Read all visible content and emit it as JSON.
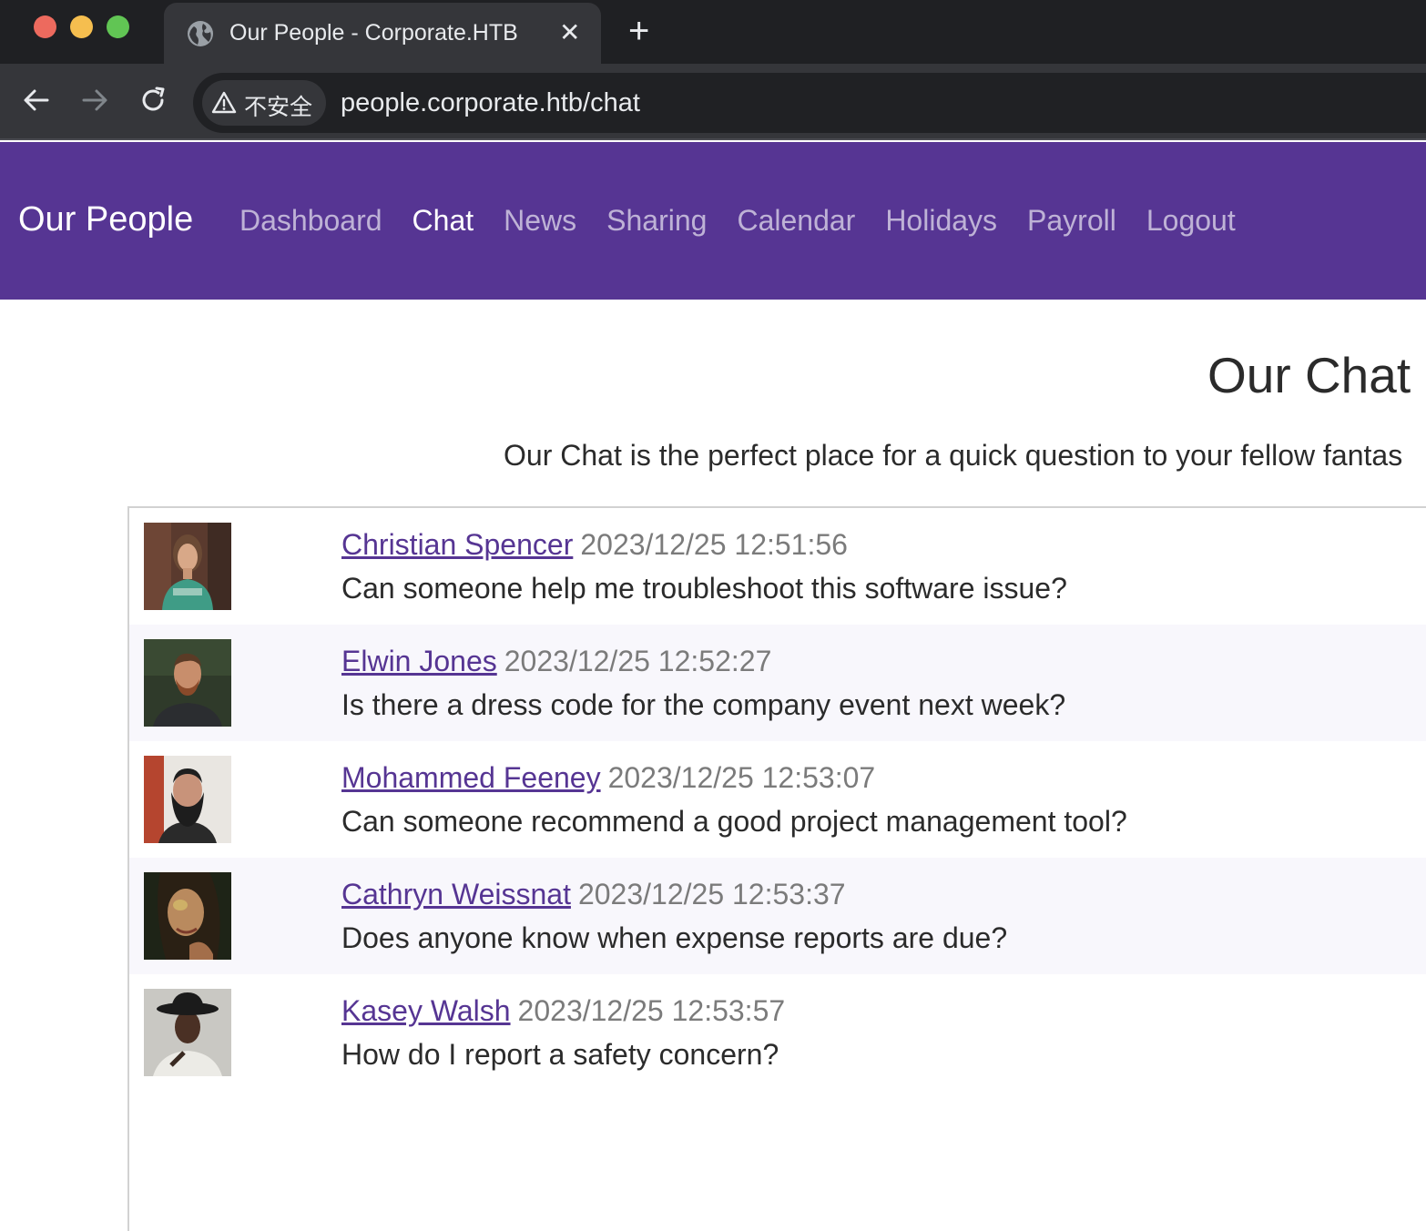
{
  "browser": {
    "tab_title": "Our People - Corporate.HTB",
    "tab_close": "✕",
    "new_tab": "+",
    "security_label": "不安全",
    "url": "people.corporate.htb/chat"
  },
  "navbar": {
    "brand": "Our People",
    "links": [
      {
        "label": "Dashboard",
        "active": false
      },
      {
        "label": "Chat",
        "active": true
      },
      {
        "label": "News",
        "active": false
      },
      {
        "label": "Sharing",
        "active": false
      },
      {
        "label": "Calendar",
        "active": false
      },
      {
        "label": "Holidays",
        "active": false
      },
      {
        "label": "Payroll",
        "active": false
      },
      {
        "label": "Logout",
        "active": false
      }
    ],
    "color": "#563593"
  },
  "page": {
    "title": "Our Chat",
    "lead": "Our Chat is the perfect place for a quick question to your fellow fantas"
  },
  "messages": [
    {
      "author": "Christian Spencer",
      "time": "2023/12/25 12:51:56",
      "text": "Can someone help me troubleshoot this software issue?"
    },
    {
      "author": "Elwin Jones",
      "time": "2023/12/25 12:52:27",
      "text": "Is there a dress code for the company event next week?"
    },
    {
      "author": "Mohammed Feeney",
      "time": "2023/12/25 12:53:07",
      "text": "Can someone recommend a good project management tool?"
    },
    {
      "author": "Cathryn Weissnat",
      "time": "2023/12/25 12:53:37",
      "text": "Does anyone know when expense reports are due?"
    },
    {
      "author": "Kasey Walsh",
      "time": "2023/12/25 12:53:57",
      "text": "How do I report a safety concern?"
    }
  ]
}
